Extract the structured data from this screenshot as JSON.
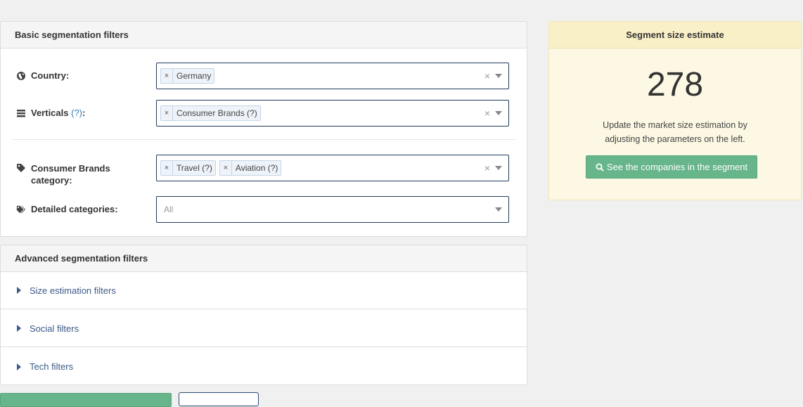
{
  "basic": {
    "title": "Basic segmentation filters",
    "country": {
      "label": "Country:",
      "tags": [
        "Germany"
      ]
    },
    "verticals": {
      "label": "Verticals",
      "help": "(?)",
      "colon": ":",
      "tags": [
        "Consumer Brands (?)"
      ]
    },
    "consumer_category": {
      "label_line1": "Consumer Brands",
      "label_line2": "category:",
      "tags": [
        "Travel (?)",
        "Aviation (?)"
      ]
    },
    "detailed": {
      "label": "Detailed categories:",
      "placeholder": "All"
    },
    "remove_glyph": "×",
    "clear_glyph": "×"
  },
  "advanced": {
    "title": "Advanced segmentation filters",
    "sections": [
      "Size estimation filters",
      "Social filters",
      "Tech filters"
    ]
  },
  "estimate": {
    "title": "Segment size estimate",
    "value": "278",
    "description_line1": "Update the market size estimation by",
    "description_line2": "adjusting the parameters on the left.",
    "button_label": "See the companies in the segment"
  },
  "colors": {
    "accent": "#3b5b88",
    "green": "#67b58a",
    "estimate_bg": "#fcf8e3"
  }
}
